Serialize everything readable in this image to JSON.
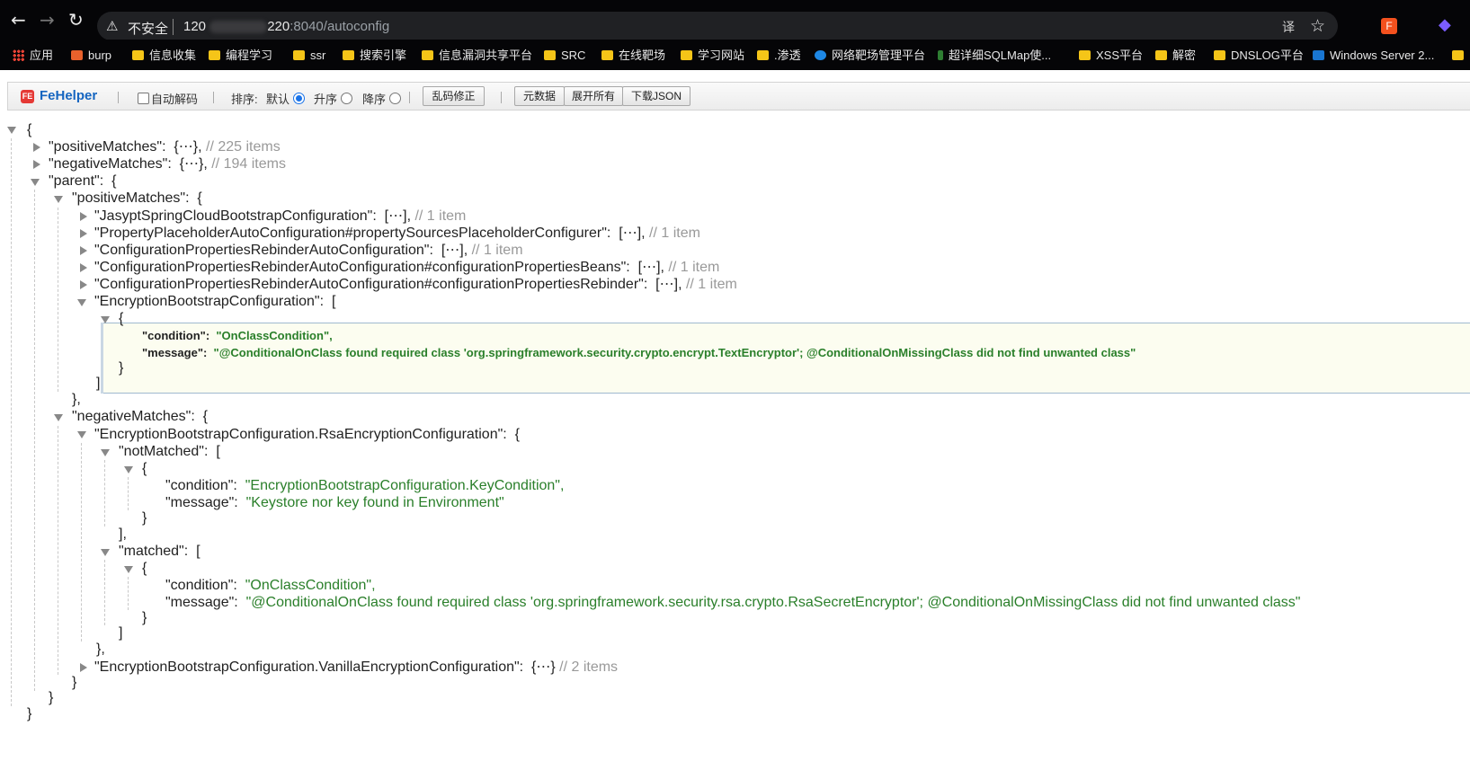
{
  "browser": {
    "back_icon": "arrow-left-icon",
    "forward_icon": "arrow-right-icon",
    "reload_icon": "reload-icon",
    "security_text": "不安全",
    "host_prefix": "120",
    "host_suffix": "220",
    "url_path": ":8040/autoconfig"
  },
  "bookmarks": [
    {
      "label": "应用",
      "icon": "apps-grid-icon"
    },
    {
      "label": "burp",
      "icon": "burp-icon"
    },
    {
      "label": "信息收集",
      "icon": "folder-icon"
    },
    {
      "label": "编程学习",
      "icon": "folder-icon"
    },
    {
      "label": "ssr",
      "icon": "folder-icon"
    },
    {
      "label": "搜索引擎",
      "icon": "folder-icon"
    },
    {
      "label": "信息漏洞共享平台",
      "icon": "folder-icon"
    },
    {
      "label": "SRC",
      "icon": "folder-icon"
    },
    {
      "label": "在线靶场",
      "icon": "folder-icon"
    },
    {
      "label": "学习网站",
      "icon": "folder-icon"
    },
    {
      "label": ".渗透",
      "icon": "folder-icon"
    },
    {
      "label": "网络靶场管理平台",
      "icon": "globe-icon"
    },
    {
      "label": "超详细SQLMap使...",
      "icon": "sql-icon"
    },
    {
      "label": "XSS平台",
      "icon": "folder-icon"
    },
    {
      "label": "解密",
      "icon": "folder-icon"
    },
    {
      "label": "DNSLOG平台",
      "icon": "folder-icon"
    },
    {
      "label": "Windows Server 2...",
      "icon": "windows-icon"
    }
  ],
  "fehelper": {
    "brand": "FeHelper",
    "logo": "FE",
    "auto_decode": "自动解码",
    "sort_label": "排序:",
    "sort_default": "默认",
    "sort_asc": "升序",
    "sort_desc": "降序",
    "fix_encoding": "乱码修正",
    "raw_data": "元数据",
    "expand_all": "展开所有",
    "download_json": "下载JSON"
  },
  "json": {
    "open_brace": "{",
    "close_brace": "}",
    "open_bracket": "[",
    "close_bracket": "]",
    "ellipsis": "⋯",
    "top_positive": {
      "key": "\"positiveMatches\":",
      "comment": "// 225 items"
    },
    "top_negative": {
      "key": "\"negativeMatches\":",
      "comment": "// 194 items"
    },
    "parent_key": "\"parent\":",
    "positive_key": "\"positiveMatches\":",
    "negative_key": "\"negativeMatches\":",
    "positive_entries": [
      {
        "key": "\"JasyptSpringCloudBootstrapConfiguration\":",
        "comment": "// 1 item"
      },
      {
        "key": "\"PropertyPlaceholderAutoConfiguration#propertySourcesPlaceholderConfigurer\":",
        "comment": "// 1 item"
      },
      {
        "key": "\"ConfigurationPropertiesRebinderAutoConfiguration\":",
        "comment": "// 1 item"
      },
      {
        "key": "\"ConfigurationPropertiesRebinderAutoConfiguration#configurationPropertiesBeans\":",
        "comment": "// 1 item"
      },
      {
        "key": "\"ConfigurationPropertiesRebinderAutoConfiguration#configurationPropertiesRebinder\":",
        "comment": "// 1 item"
      }
    ],
    "encryption_key": "\"EncryptionBootstrapConfiguration\":",
    "encryption_condition": {
      "key": "\"condition\":",
      "value": "\"OnClassCondition\","
    },
    "encryption_message": {
      "key": "\"message\":",
      "value": "\"@ConditionalOnClass found required class 'org.springframework.security.crypto.encrypt.TextEncryptor'; @ConditionalOnMissingClass did not find unwanted class\""
    },
    "rsa_key": "\"EncryptionBootstrapConfiguration.RsaEncryptionConfiguration\":",
    "not_matched_key": "\"notMatched\":",
    "not_matched_condition": {
      "key": "\"condition\":",
      "value": "\"EncryptionBootstrapConfiguration.KeyCondition\","
    },
    "not_matched_message": {
      "key": "\"message\":",
      "value": "\"Keystore nor key found in Environment\""
    },
    "matched_key": "\"matched\":",
    "matched_condition": {
      "key": "\"condition\":",
      "value": "\"OnClassCondition\","
    },
    "matched_message": {
      "key": "\"message\":",
      "value": "\"@ConditionalOnClass found required class 'org.springframework.security.rsa.crypto.RsaSecretEncryptor'; @ConditionalOnMissingClass did not find unwanted class\""
    },
    "vanilla_key": "\"EncryptionBootstrapConfiguration.VanillaEncryptionConfiguration\":",
    "vanilla_comment": "// 2 items"
  }
}
